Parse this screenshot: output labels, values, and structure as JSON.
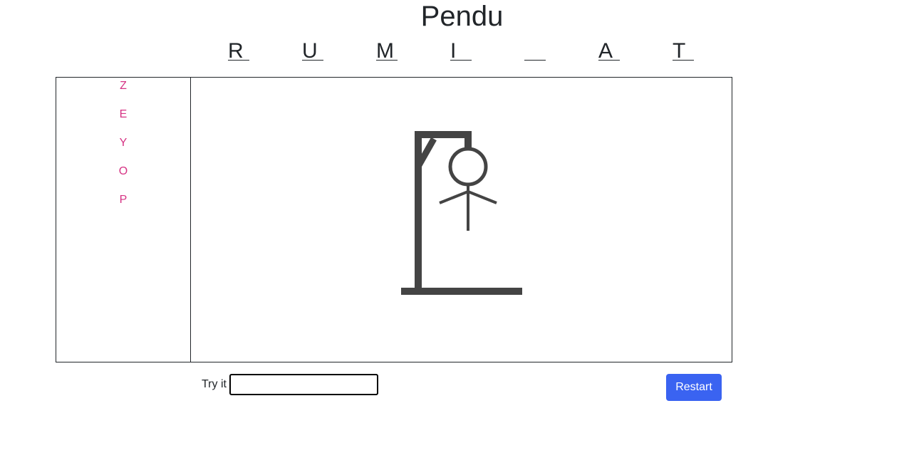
{
  "header": {
    "title": "Pendu"
  },
  "word": {
    "letters": [
      "R",
      "U",
      "M",
      "I",
      "",
      "A",
      "T"
    ]
  },
  "wrong_letters": [
    "Z",
    "E",
    "Y",
    "O",
    "P"
  ],
  "guess": {
    "label": "Try it",
    "value": "",
    "placeholder": ""
  },
  "actions": {
    "restart_label": "Restart"
  },
  "colors": {
    "wrong_letter": "#d63384",
    "drawing": "#444444",
    "button": "#3a63f1"
  }
}
